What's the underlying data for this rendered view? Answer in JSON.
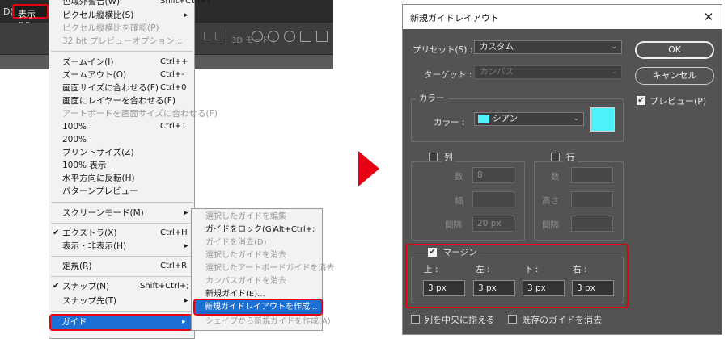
{
  "menubar": {
    "fragment": "D)",
    "view_label": "表示(V)"
  },
  "optbar": {
    "mode_label": "3D モード :"
  },
  "view_menu": {
    "top_items": [
      {
        "label": "色域外警告(W)",
        "shortcut": "Shift+Ctrl+Y"
      },
      {
        "label": "ピクセル縦横比(S)",
        "arrow": "▸"
      },
      {
        "label": "ピクセル縦横比を確認(P)",
        "disabled": true
      },
      {
        "label": "32 bit プレビューオプション...",
        "disabled": true
      }
    ],
    "zoom_items": [
      {
        "label": "ズームイン(I)",
        "shortcut": "Ctrl++"
      },
      {
        "label": "ズームアウト(O)",
        "shortcut": "Ctrl+-"
      },
      {
        "label": "画面サイズに合わせる(F)",
        "shortcut": "Ctrl+0"
      },
      {
        "label": "画面にレイヤーを合わせる(F)"
      },
      {
        "label": "アートボードを画面サイズに合わせる(F)",
        "disabled": true
      },
      {
        "label": "100%",
        "shortcut": "Ctrl+1"
      },
      {
        "label": "200%"
      },
      {
        "label": "プリントサイズ(Z)"
      },
      {
        "label": "100% 表示"
      },
      {
        "label": "水平方向に反転(H)"
      },
      {
        "label": "パターンプレビュー"
      }
    ],
    "screen_mode": {
      "label": "スクリーンモード(M)",
      "arrow": "▸"
    },
    "extras": {
      "label": "エクストラ(X)",
      "shortcut": "Ctrl+H",
      "check": "✔"
    },
    "show": {
      "label": "表示・非表示(H)",
      "arrow": "▸"
    },
    "rulers": {
      "label": "定規(R)",
      "shortcut": "Ctrl+R"
    },
    "snap": {
      "label": "スナップ(N)",
      "shortcut": "Shift+Ctrl+;",
      "check": "✔"
    },
    "snap_to": {
      "label": "スナップ先(T)",
      "arrow": "▸"
    },
    "guides": {
      "label": "ガイド",
      "arrow": "▸"
    }
  },
  "guide_submenu": {
    "items": [
      {
        "label": "選択したガイドを編集",
        "disabled": true
      },
      {
        "label": "ガイドをロック(G)",
        "shortcut": "Alt+Ctrl+;"
      },
      {
        "label": "ガイドを消去(D)",
        "disabled": true
      },
      {
        "label": "選択したガイドを消去",
        "disabled": true
      },
      {
        "label": "選択したアートボードガイドを消去",
        "disabled": true
      },
      {
        "label": "カンバスガイドを消去",
        "disabled": true
      },
      {
        "label": "新規ガイド(E)..."
      }
    ],
    "new_layout": "新規ガイドレイアウトを作成...",
    "from_shape": "シェイプから新規ガイドを作成(A)"
  },
  "dialog": {
    "title": "新規ガイドレイアウト",
    "close_glyph": "✕",
    "preset_label": "プリセット(S) :",
    "preset_value": "カスタム",
    "target_label": "ターゲット :",
    "target_value": "カンバス",
    "color_section": "カラー",
    "color_label": "カラー :",
    "color_value": "シアン",
    "color_hex": "#4ef1f9",
    "columns": {
      "label": "列",
      "number_label": "数",
      "number_value": "8",
      "width_label": "幅",
      "width_value": "",
      "gutter_label": "間隔",
      "gutter_value": "20 px"
    },
    "rows": {
      "label": "行",
      "number_label": "数",
      "number_value": "",
      "height_label": "高さ",
      "height_value": "",
      "gutter_label": "間隔",
      "gutter_value": ""
    },
    "margin": {
      "label": "マージン",
      "top_label": "上 :",
      "left_label": "左 :",
      "bottom_label": "下 :",
      "right_label": "右 :",
      "top_value": "3 px",
      "left_value": "3 px",
      "bottom_value": "3 px",
      "right_value": "3 px"
    },
    "center_columns_label": "列を中央に揃える",
    "clear_existing_label": "既存のガイドを消去",
    "ok_label": "OK",
    "cancel_label": "キャンセル",
    "preview_label": "プレビュー(P)",
    "check_glyph": "✔",
    "dropdown_glyph": "⌄"
  },
  "colors": {
    "accent_red": "#e60012",
    "menu_highlight": "#1c6fd4",
    "dialog_bg": "#535353"
  }
}
